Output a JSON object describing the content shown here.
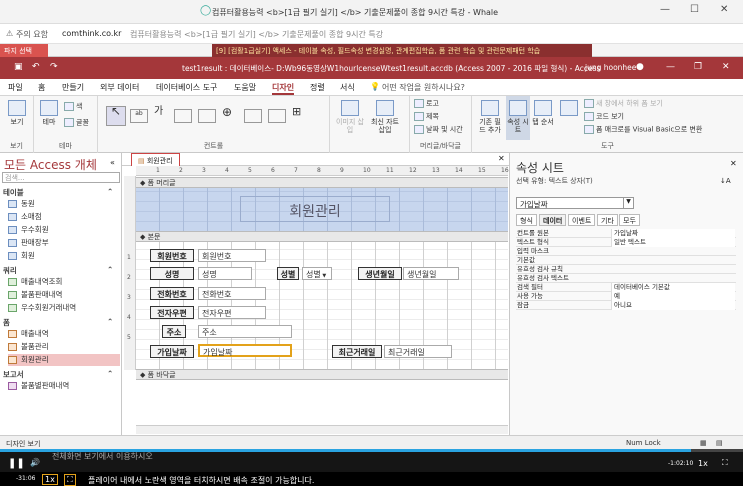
{
  "browser": {
    "window_title": "컴퓨터활용능력 <b>[1급 필기 실기] </b> 기출문제풀이 종합 9시간 특강 - Whale",
    "warning_label": "주의 요함",
    "url": "comthink.co.kr",
    "page_title": "컴퓨터활용능력 <b>[1급 필기 실기] </b> 기출문제풀이 종합 9시간 특강"
  },
  "notice": {
    "tag": "파지 선택",
    "text": "[9] [컴활1급실기] 액세스 - 테이블 속성, 필드속성 변경실명, 관계편집학습, 폼 관련 학습 및 관련문제패턴 학습"
  },
  "access": {
    "title": "test1result : 데이터베이스- D:Wb96동영상W1hourlcenseWtest1result.accdb (Access 2007 - 2016 파일 형식) - Access",
    "user": "jung hoonhee"
  },
  "ribbon_tabs": [
    "파일",
    "홈",
    "만들기",
    "외부 데이터",
    "데이터베이스 도구",
    "도움말",
    "디자인",
    "정렬",
    "서식",
    "어떤 작업을 원하시나요?"
  ],
  "ribbon": {
    "view_label": "보기",
    "views_group": "보기",
    "theme_label": "테마",
    "color_label": "색",
    "font_label": "글꼴",
    "themes_group": "테마",
    "controls_group": "컨트롤",
    "insert_image": "이미지 삽입",
    "add_fields": "최신 자트 삽입",
    "logo": "로고",
    "title_btn": "제목",
    "datetime": "날짜 및 시간",
    "header_footer_group": "머리글/바닥글",
    "existing_fields": "기존 필드 추가",
    "property_sheet": "속성 시트",
    "tab_order": "탭 순서",
    "subform_new_window": "새 창에서 하위 폼 보기",
    "view_code": "코드 보기",
    "convert_macros": "폼 매크로를 Visual Basic으로 변환",
    "tools_group": "도구"
  },
  "nav": {
    "header": "모든 Access 개체",
    "search_placeholder": "검색...",
    "sections": [
      {
        "name": "테이블",
        "items": [
          "동원",
          "소매점",
          "우수회원",
          "판매장부",
          "회원"
        ]
      },
      {
        "name": "쿼리",
        "items": [
          "매출내역조회",
          "볼품판매내역",
          "우수회원거래내역"
        ]
      },
      {
        "name": "폼",
        "items": [
          "매출내역",
          "볼품관리",
          "회원관리"
        ]
      },
      {
        "name": "보고서",
        "items": [
          "볼품별판매내역"
        ]
      }
    ]
  },
  "document": {
    "tab": "회원관리",
    "form_header_bar": "폼 머리글",
    "detail_bar": "본문",
    "form_footer_bar": "폼 바닥글",
    "header_title": "회원관리",
    "ruler_marks": [
      "1",
      "2",
      "3",
      "4",
      "5",
      "6",
      "7",
      "8",
      "9",
      "10",
      "11",
      "12",
      "13",
      "14",
      "15",
      "16"
    ],
    "vruler_marks": [
      "1",
      "2",
      "3",
      "4",
      "5"
    ],
    "labels": [
      "회원번호",
      "성명",
      "성별",
      "생년월일",
      "전화번호",
      "전자우편",
      "주소",
      "가입날짜",
      "최근거래일"
    ],
    "fields": [
      "회원번호",
      "성명",
      "성별",
      "생년월일",
      "전화번호",
      "전자우편",
      "주소",
      "가입날짜",
      "최근거래일"
    ]
  },
  "property_sheet": {
    "title": "속성 시트",
    "selection": "선택 유형: 텍스트 상자(T)",
    "selected_object": "가입날짜",
    "tabs": [
      "형식",
      "데이터",
      "이벤트",
      "기타",
      "모두"
    ],
    "rows": [
      [
        "컨트롤 원본",
        "가입날짜"
      ],
      [
        "텍스트 형식",
        "일반 텍스트"
      ],
      [
        "입력 마스크",
        ""
      ],
      [
        "기본값",
        ""
      ],
      [
        "유효성 검사 규칙",
        ""
      ],
      [
        "유효성 검사 텍스트",
        ""
      ],
      [
        "검색 필터",
        "데이터베이스 기본값"
      ],
      [
        "사용 가능",
        "예"
      ],
      [
        "잠금",
        "아니요"
      ]
    ]
  },
  "status": {
    "left": "디자인 보기",
    "right": "Num Lock"
  },
  "player": {
    "subtitle_ghost": "전체화면 보기에서 이용하시오",
    "elapsed": "-1:02:10",
    "speed": "1x",
    "bottom_time": "-31:06",
    "bottom_speed": "1x",
    "hint": "플레이어 내에서 노란색 영역을 터치하시면 배속 조절이 가능합니다.",
    "progress": 0.93
  }
}
